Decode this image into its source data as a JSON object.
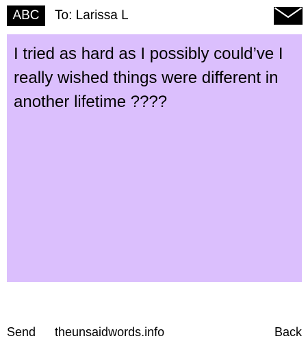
{
  "header": {
    "input_mode": "ABC",
    "recipient": "To: Larissa L",
    "envelope_icon": "envelope-icon"
  },
  "message": {
    "text": "I tried as hard as I possibly could’ve I really wished things were different in another lifetime ????",
    "background_color": "#dbbffd"
  },
  "footer": {
    "send_label": "Send",
    "site_label": "theunsaidwords.info",
    "back_label": "Back"
  }
}
